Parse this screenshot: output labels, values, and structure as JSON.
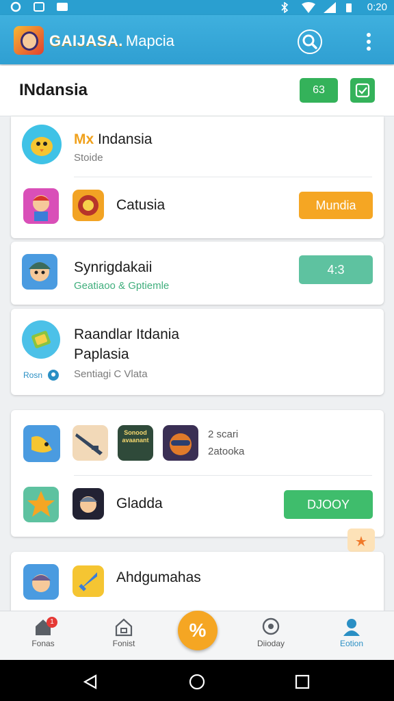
{
  "status_bar": {
    "time": "0:20"
  },
  "app_bar": {
    "brand": "GAIJASA.",
    "subtitle": "Mapcia"
  },
  "header": {
    "title": "INdansia",
    "badge_button": "63"
  },
  "card1": {
    "row1": {
      "highlight": "Mx",
      "name": "Indansia",
      "sub": "Stoide"
    },
    "row2": {
      "name": "Catusia",
      "button": "Mundia"
    }
  },
  "card2": {
    "name": "Synrigdakaii",
    "sub": "Geatiaoo & Gptiemle",
    "button": "4:3"
  },
  "card3": {
    "name_line1": "Raandlar Itdania",
    "name_line2": "Paplasia",
    "tag": "Rosn",
    "sub": "Sentiagi C Vlata"
  },
  "card4": {
    "thumb_text": "Sonood avaanant",
    "meta_line1": "2 scari",
    "meta_line2": "2atooka",
    "row2": {
      "name": "Gladda",
      "button": "DJOOY"
    }
  },
  "card5": {
    "name": "Ahdgumahas"
  },
  "bottom_nav": {
    "items": [
      {
        "label": "Fonas",
        "badge": "1"
      },
      {
        "label": "Fonist"
      },
      {
        "label": "Diioday"
      },
      {
        "label": "Eotion"
      }
    ],
    "fab_label": "%"
  },
  "colors": {
    "app_bar": "#35a8d9",
    "accent_green": "#34b25a",
    "accent_orange": "#f5a623",
    "teal": "#5ec2a0",
    "active_nav": "#2a8fc4"
  }
}
